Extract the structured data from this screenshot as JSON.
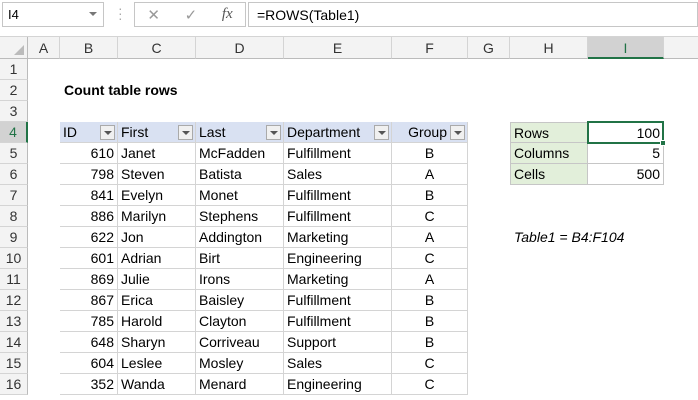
{
  "formula_bar": {
    "name_box": "I4",
    "cancel_icon": "✕",
    "enter_icon": "✓",
    "fx_label": "fx",
    "formula": "=ROWS(Table1)"
  },
  "columns": [
    "A",
    "B",
    "C",
    "D",
    "E",
    "F",
    "G",
    "H",
    "I"
  ],
  "rows": [
    "1",
    "2",
    "3",
    "4",
    "5",
    "6",
    "7",
    "8",
    "9",
    "10",
    "11",
    "12",
    "13",
    "14",
    "15",
    "16"
  ],
  "title": "Count table rows",
  "table": {
    "headers": [
      "ID",
      "First",
      "Last",
      "Department",
      "Group"
    ],
    "rows": [
      [
        "610",
        "Janet",
        "McFadden",
        "Fulfillment",
        "B"
      ],
      [
        "798",
        "Steven",
        "Batista",
        "Sales",
        "A"
      ],
      [
        "841",
        "Evelyn",
        "Monet",
        "Fulfillment",
        "B"
      ],
      [
        "886",
        "Marilyn",
        "Stephens",
        "Fulfillment",
        "C"
      ],
      [
        "622",
        "Jon",
        "Addington",
        "Marketing",
        "A"
      ],
      [
        "601",
        "Adrian",
        "Birt",
        "Engineering",
        "C"
      ],
      [
        "869",
        "Julie",
        "Irons",
        "Marketing",
        "A"
      ],
      [
        "867",
        "Erica",
        "Baisley",
        "Fulfillment",
        "B"
      ],
      [
        "785",
        "Harold",
        "Clayton",
        "Fulfillment",
        "B"
      ],
      [
        "648",
        "Sharyn",
        "Corriveau",
        "Support",
        "B"
      ],
      [
        "604",
        "Leslee",
        "Mosley",
        "Sales",
        "C"
      ],
      [
        "352",
        "Wanda",
        "Menard",
        "Engineering",
        "C"
      ]
    ]
  },
  "summary": [
    {
      "label": "Rows",
      "value": "100"
    },
    {
      "label": "Columns",
      "value": "5"
    },
    {
      "label": "Cells",
      "value": "500"
    }
  ],
  "note": "Table1 = B4:F104"
}
